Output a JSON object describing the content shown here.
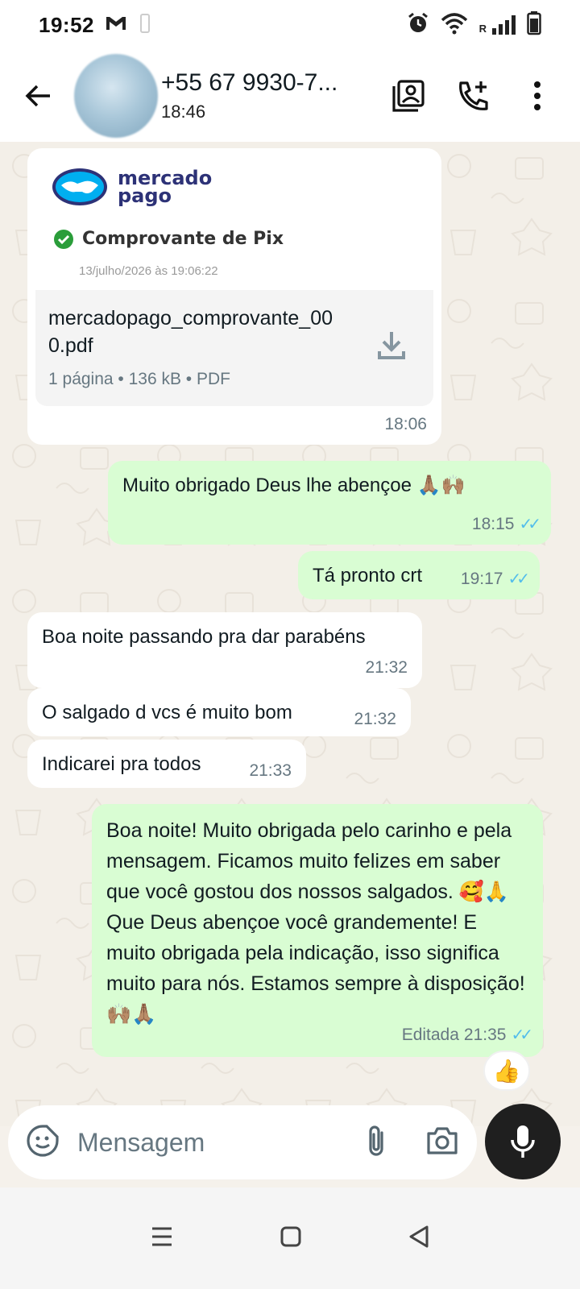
{
  "status_bar": {
    "time": "19:52",
    "carrier_letter": "R",
    "icons": [
      "gmail-icon",
      "alarm-icon",
      "wifi-icon",
      "signal-icon",
      "battery-icon"
    ]
  },
  "header": {
    "contact_name": "+55 67 9930-7...",
    "subtitle": "18:46",
    "icons": [
      "back-arrow-icon",
      "contact-card-icon",
      "add-call-icon",
      "more-vert-icon"
    ]
  },
  "messages": [
    {
      "type": "document",
      "direction": "in",
      "preview": {
        "brand_line1": "mercado",
        "brand_line2": "pago",
        "title": "Comprovante de Pix",
        "date": "13/julho/2026 às 19:06:22"
      },
      "file_name": "mercadopago_comprovante_000.pdf",
      "details": "1 página • 136 kB • PDF",
      "time": "18:06"
    },
    {
      "type": "text",
      "direction": "out",
      "text": "Muito obrigado Deus lhe abençoe 🙏🏽🙌🏽",
      "time": "18:15",
      "status": "read"
    },
    {
      "type": "text",
      "direction": "out",
      "text": "Tá pronto crt",
      "time": "19:17",
      "status": "read"
    },
    {
      "type": "text",
      "direction": "in",
      "text": "Boa noite passando pra dar parabéns",
      "time": "21:32"
    },
    {
      "type": "text",
      "direction": "in",
      "text": "O salgado d vcs é muito bom",
      "time": "21:32"
    },
    {
      "type": "text",
      "direction": "in",
      "text": "Indicarei pra todos",
      "time": "21:33"
    },
    {
      "type": "text",
      "direction": "out",
      "text": "Boa noite! Muito obrigada pelo carinho e pela mensagem. Ficamos muito felizes em saber que você gostou dos nossos salgados. 🥰🙏 Que Deus abençoe você grandemente! E muito obrigada pela indicação, isso significa muito para nós. Estamos sempre à disposição! 🙌🏽🙏🏽",
      "edited_label": "Editada",
      "time": "21:35",
      "status": "read",
      "reaction": "👍"
    }
  ],
  "composer": {
    "placeholder": "Mensagem",
    "icons": [
      "sticker-icon",
      "attach-icon",
      "camera-icon",
      "mic-icon"
    ]
  },
  "nav": {
    "icons": [
      "recents-icon",
      "home-icon",
      "back-icon"
    ]
  },
  "colors": {
    "incoming_bubble": "#ffffff",
    "outgoing_bubble": "#d9fdd3",
    "read_ticks": "#53bdeb",
    "chat_background": "#f3efe8"
  }
}
